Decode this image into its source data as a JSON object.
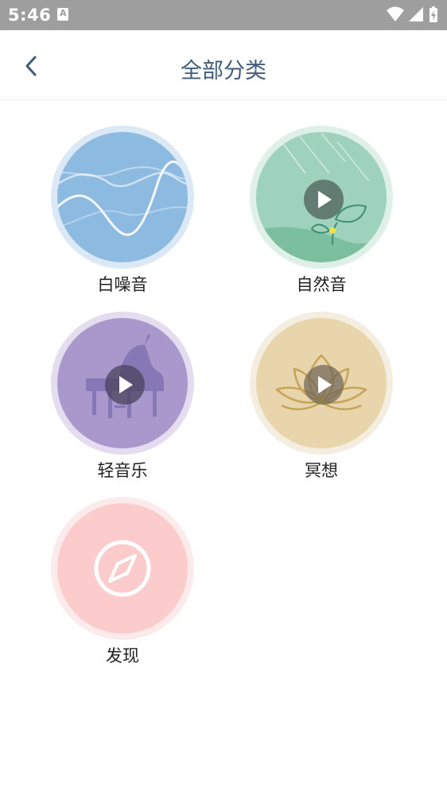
{
  "status_bar": {
    "time": "5:46",
    "icons": [
      "a-notification-icon",
      "wifi-icon",
      "signal-icon",
      "battery-charging-icon"
    ]
  },
  "header": {
    "title": "全部分类",
    "back_icon": "chevron-left-icon"
  },
  "colors": {
    "title": "#3f5d79",
    "white_noise": "#8dbae0",
    "nature": "#9ed2bc",
    "light_music": "#a998cc",
    "meditation": "#e9d5ac",
    "discover": "#fccbcb"
  },
  "categories": [
    {
      "label": "白噪音",
      "icon": "sound-wave-icon"
    },
    {
      "label": "自然音",
      "icon": "leaf-rain-icon",
      "play_icon": "play-icon"
    },
    {
      "label": "轻音乐",
      "icon": "piano-icon",
      "play_icon": "play-icon"
    },
    {
      "label": "冥想",
      "icon": "lotus-icon",
      "play_icon": "play-icon"
    },
    {
      "label": "发现",
      "icon": "compass-icon"
    }
  ]
}
